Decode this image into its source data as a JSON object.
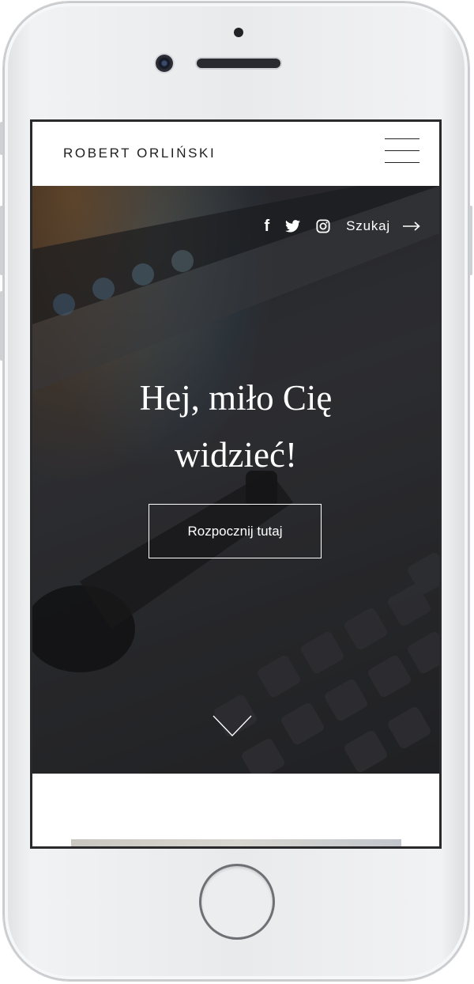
{
  "site": {
    "title": "ROBERT ORLIŃSKI"
  },
  "header": {
    "menu_icon": "hamburger-menu-icon"
  },
  "hero": {
    "social_icons": [
      "facebook-icon",
      "twitter-icon",
      "instagram-icon"
    ],
    "search_label": "Szukaj",
    "search_arrow_icon": "arrow-right-icon",
    "heading_line1": "Hej, miło Cię",
    "heading_line2": "widzieć!",
    "cta_label": "Rozpocznij tutaj",
    "scroll_icon": "chevron-down-icon"
  },
  "colors": {
    "header_bg": "#ffffff",
    "hero_text": "#ffffff",
    "hero_overlay": "#2c2d2f",
    "title_text": "#1f1f1f"
  }
}
